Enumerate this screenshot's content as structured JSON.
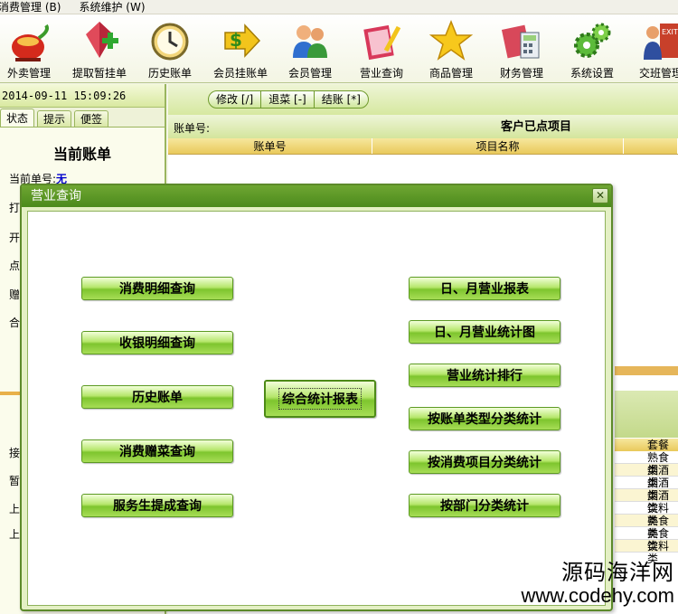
{
  "menu": [
    {
      "label": "消费管理",
      "shortcut": "(B)"
    },
    {
      "label": "系统维护",
      "shortcut": "(W)"
    }
  ],
  "toolbar": [
    {
      "label": "外卖管理",
      "icon": "takeout-teapot-icon"
    },
    {
      "label": "提取暂挂单",
      "icon": "retrieve-pending-icon"
    },
    {
      "label": "历史账单",
      "icon": "history-clock-icon"
    },
    {
      "label": "会员挂账单",
      "icon": "member-credit-icon"
    },
    {
      "label": "会员管理",
      "icon": "members-people-icon"
    },
    {
      "label": "营业查询",
      "icon": "business-query-icon"
    },
    {
      "label": "商品管理",
      "icon": "goods-star-icon"
    },
    {
      "label": "财务管理",
      "icon": "finance-calculator-icon"
    },
    {
      "label": "系统设置",
      "icon": "settings-gears-icon"
    },
    {
      "label": "交班管理",
      "icon": "shift-exit-icon"
    }
  ],
  "left_panel": {
    "datetime": "2014-09-11 15:09:26",
    "tabs": [
      "状态",
      "提示",
      "便签"
    ],
    "bill_title": "当前账单",
    "current_bill_label": "当前单号:",
    "current_bill_value": "无",
    "line_fragments": [
      "打",
      "开",
      "点",
      "赠",
      "合"
    ],
    "lower_fragments": [
      "接",
      "暂",
      "上",
      "上"
    ]
  },
  "right_panel": {
    "actions": [
      "修改 [/]",
      "退菜 [-]",
      "结账 [*]"
    ],
    "account_label": "账单号:",
    "project_title": "客户已点项目",
    "columns": [
      "账单号",
      "项目名称"
    ],
    "strip_header": "套餐",
    "strip_rows": [
      "熟食类",
      "烟酒类",
      "烟酒类",
      "烟酒类",
      "饮料类",
      "熟食类",
      "熟食类",
      "饮料类"
    ]
  },
  "dialog": {
    "title": "营业查询",
    "close": "✕",
    "left_buttons": [
      "消费明细查询",
      "收银明细查询",
      "历史账单",
      "消费赠菜查询",
      "服务生提成查询"
    ],
    "center_button": "综合统计报表",
    "right_buttons": [
      "日、月营业报表",
      "日、月营业统计图",
      "营业统计排行",
      "按账单类型分类统计",
      "按消费项目分类统计",
      "按部门分类统计"
    ]
  },
  "watermark": {
    "cn": "源码海洋网",
    "url": "www.codehy.com"
  },
  "colors": {
    "button_green": "#7ec52e",
    "title_green": "#4b8a1c",
    "header_gold": "#e9c95b"
  }
}
